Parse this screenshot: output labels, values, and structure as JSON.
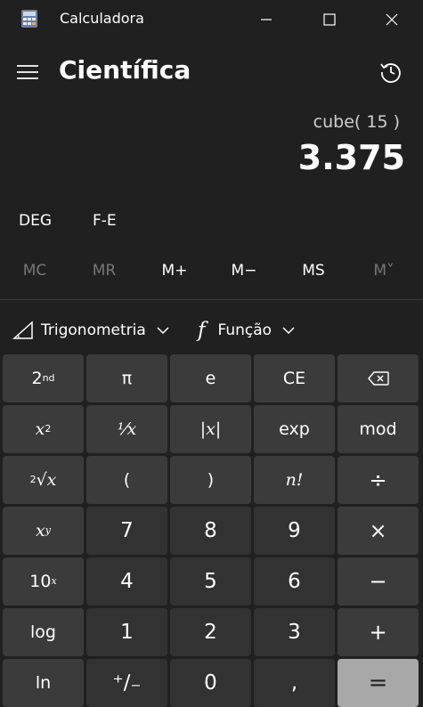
{
  "window": {
    "title": "Calculadora",
    "icons": {
      "minimize": "minimize-icon",
      "maximize": "maximize-icon",
      "close": "close-icon",
      "app": "calculator-app-icon"
    }
  },
  "header": {
    "mode_title": "Científica",
    "menu_icon": "hamburger-icon",
    "history_icon": "history-icon"
  },
  "display": {
    "expression": "cube( 15 )",
    "result": "3.375"
  },
  "modes": {
    "angle": "DEG",
    "notation": "F-E"
  },
  "memory": [
    {
      "label": "MC",
      "enabled": false
    },
    {
      "label": "MR",
      "enabled": false
    },
    {
      "label": "M+",
      "enabled": true
    },
    {
      "label": "M−",
      "enabled": true
    },
    {
      "label": "MS",
      "enabled": true
    },
    {
      "label": "M˅",
      "enabled": false
    }
  ],
  "functions": {
    "trig_label": "Trigonometria",
    "trig_icon": "triangle-ruler-icon",
    "func_label": "Função",
    "func_icon": "function-f-icon",
    "chevron_icon": "chevron-down-icon"
  },
  "keys": {
    "second": "2",
    "second_sup": "nd",
    "pi": "π",
    "e": "e",
    "ce": "CE",
    "backspace_icon": "backspace-icon",
    "square_base": "x",
    "square_exp": "2",
    "reciprocal": "⅟x",
    "abs": "|x|",
    "exp": "exp",
    "mod": "mod",
    "sqrt_root": "2",
    "sqrt_symbol": "√x",
    "lparen": "(",
    "rparen": ")",
    "factorial": "n!",
    "divide": "÷",
    "power_base": "x",
    "power_exp": "y",
    "seven": "7",
    "eight": "8",
    "nine": "9",
    "multiply": "×",
    "ten_pow_base": "10",
    "ten_pow_exp": "x",
    "four": "4",
    "five": "5",
    "six": "6",
    "minus": "−",
    "log": "log",
    "one": "1",
    "two": "2",
    "three": "3",
    "plus": "+",
    "ln": "ln",
    "negate": "⁺∕₋",
    "zero": "0",
    "decimal": ",",
    "equals": "="
  },
  "colors": {
    "background": "#202020",
    "key": "#3b3b3b",
    "number_key": "#323232",
    "equals_key": "#a8a8a8",
    "disabled_text": "#777777"
  }
}
